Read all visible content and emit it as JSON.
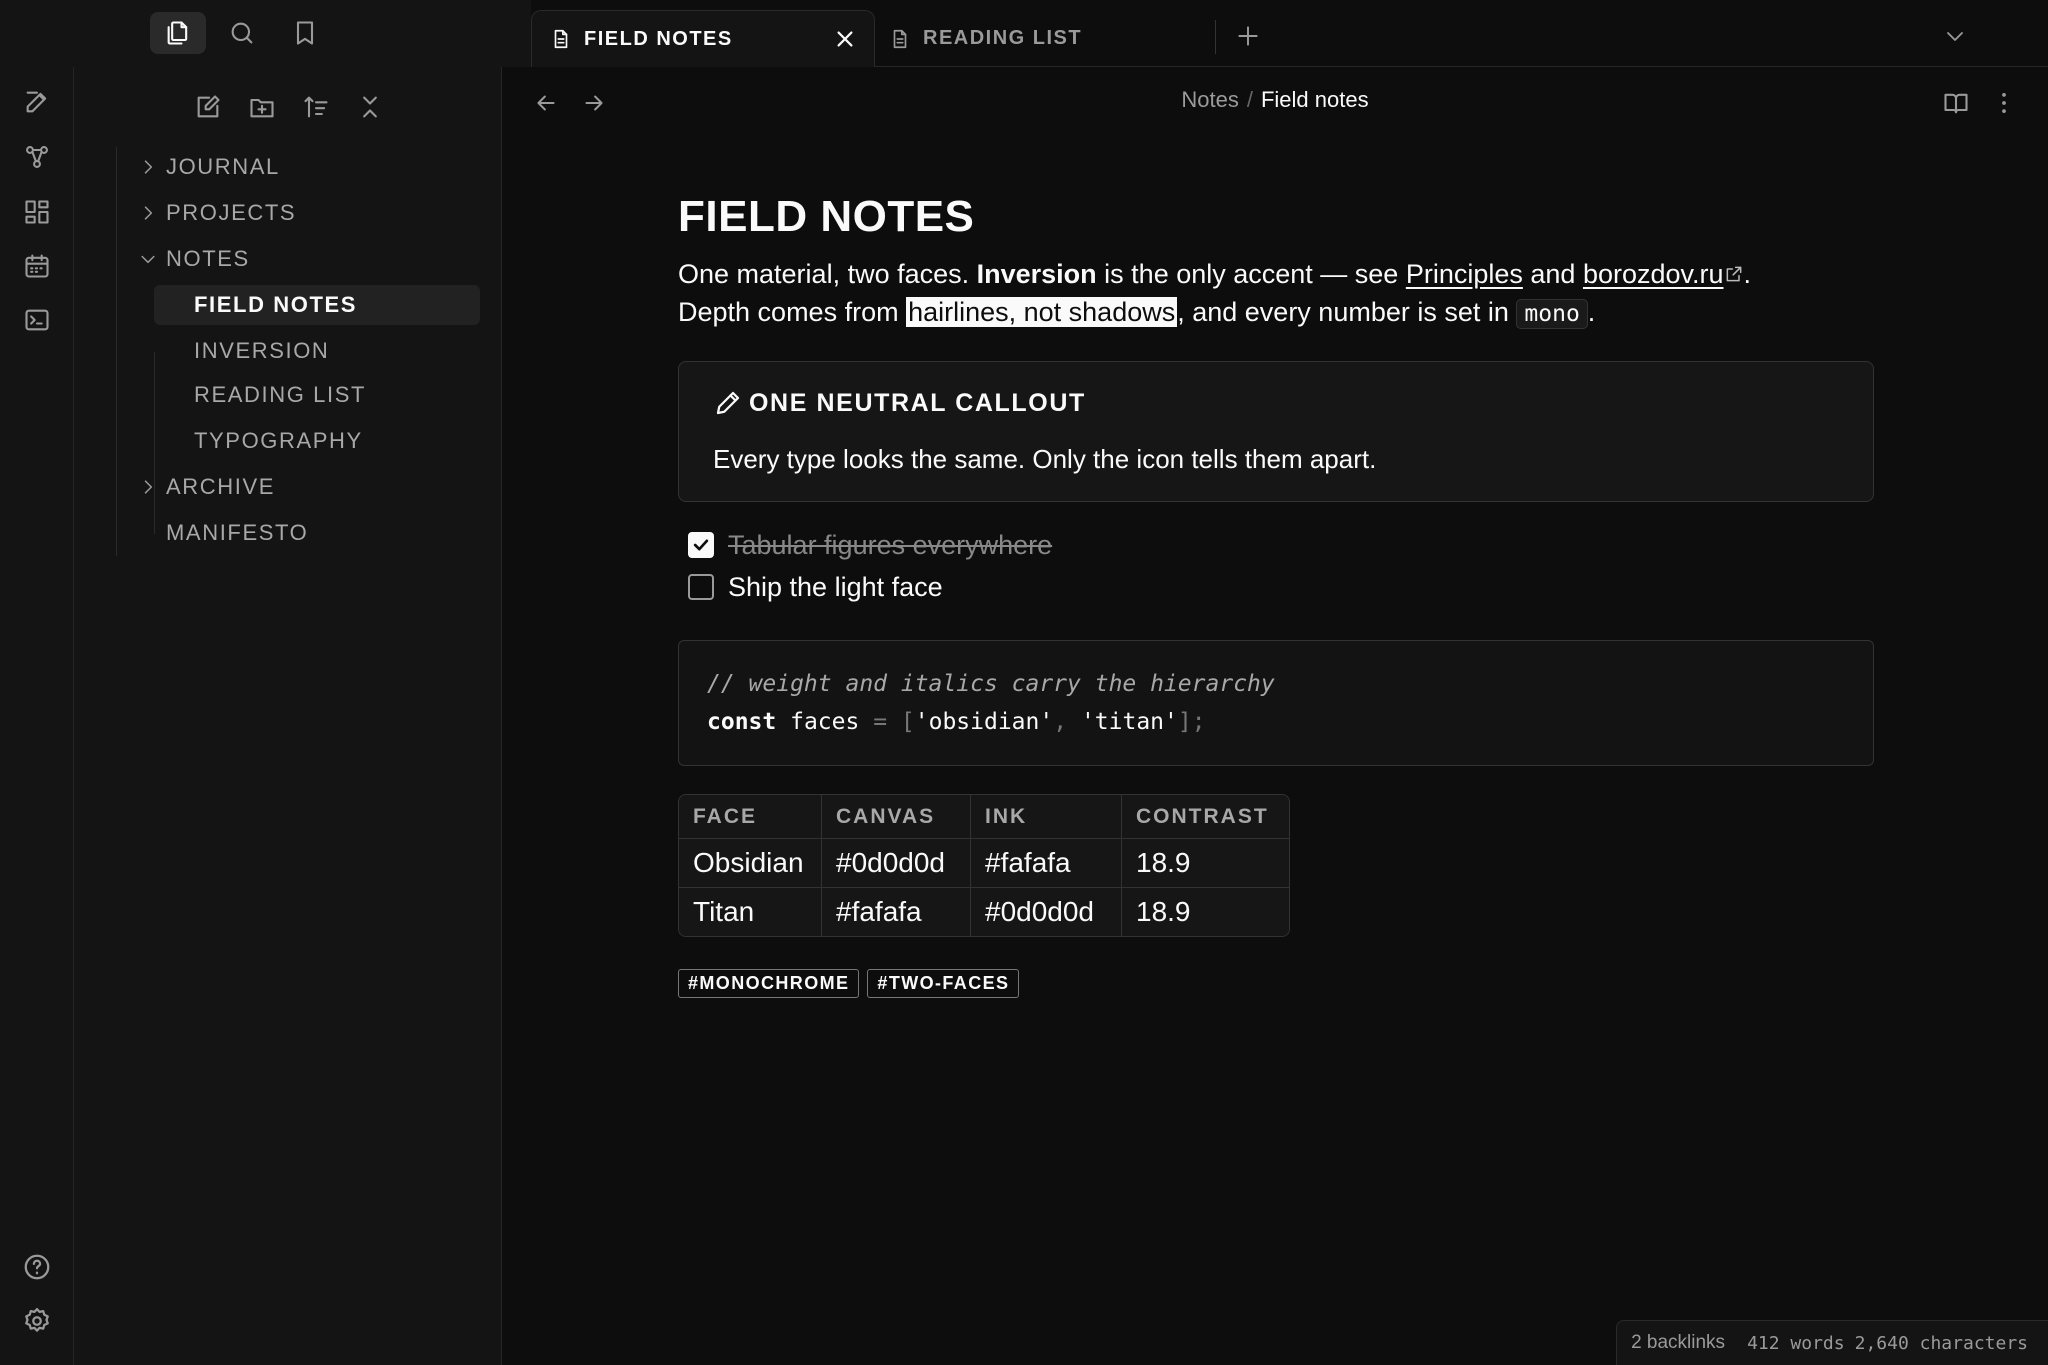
{
  "tabs": [
    {
      "label": "FIELD NOTES",
      "active": true
    },
    {
      "label": "READING LIST",
      "active": false
    }
  ],
  "sidebar": {
    "tree": [
      {
        "label": "JOURNAL",
        "kind": "folder",
        "expanded": false
      },
      {
        "label": "PROJECTS",
        "kind": "folder",
        "expanded": false
      },
      {
        "label": "NOTES",
        "kind": "folder",
        "expanded": true
      },
      {
        "label": "FIELD NOTES",
        "kind": "file",
        "selected": true
      },
      {
        "label": "INVERSION",
        "kind": "file"
      },
      {
        "label": "READING LIST",
        "kind": "file"
      },
      {
        "label": "TYPOGRAPHY",
        "kind": "file"
      },
      {
        "label": "ARCHIVE",
        "kind": "folder",
        "expanded": false
      },
      {
        "label": "MANIFESTO",
        "kind": "file-root"
      }
    ]
  },
  "breadcrumb": {
    "parent": "Notes",
    "separator": "/",
    "current": "Field notes"
  },
  "note": {
    "title": "FIELD NOTES",
    "intro": {
      "t1": "One material, two faces. ",
      "bold": "Inversion",
      "t2": " is the only accent — see ",
      "link1": "Principles",
      "t3": " and ",
      "link2": "borozdov.ru",
      "t4": ".",
      "t5": "Depth comes from ",
      "highlight": "hairlines, not shadows",
      "t6": ", and every number is set in ",
      "code": "mono",
      "t7": "."
    },
    "callout": {
      "title": "ONE NEUTRAL CALLOUT",
      "body": "Every type looks the same. Only the icon tells them apart."
    },
    "tasks": [
      {
        "text": "Tabular figures everywhere",
        "done": true
      },
      {
        "text": "Ship the light face",
        "done": false
      }
    ],
    "code": {
      "comment": "// weight and italics carry the hierarchy",
      "keyword": "const",
      "name": " faces ",
      "op": "= ",
      "open": "[",
      "s1": "'obsidian'",
      "comma": ", ",
      "s2": "'titan'",
      "close": "];"
    },
    "table": {
      "headers": [
        "FACE",
        "CANVAS",
        "INK",
        "CONTRAST"
      ],
      "rows": [
        [
          "Obsidian",
          "#0d0d0d",
          "#fafafa",
          "18.9"
        ],
        [
          "Titan",
          "#fafafa",
          "#0d0d0d",
          "18.9"
        ]
      ]
    },
    "tags": [
      "#MONOCHROME",
      "#TWO-FACES"
    ]
  },
  "status": {
    "backlinks": "2 backlinks",
    "words": "412 words",
    "characters": "2,640 characters"
  },
  "icons": {
    "ribbon": [
      "new-note-icon",
      "graph-icon",
      "canvas-icon",
      "calendar-icon",
      "terminal-icon",
      "help-icon",
      "settings-icon"
    ],
    "topbar": [
      "files-icon",
      "search-icon",
      "bookmark-icon"
    ],
    "sidebar_tools": [
      "new-note-icon",
      "new-folder-icon",
      "sort-icon",
      "collapse-all-icon"
    ]
  },
  "colors": {
    "canvas": "#0d0d0d",
    "ink": "#fafafa",
    "panel": "#141414",
    "muted": "#9a9a9a"
  }
}
